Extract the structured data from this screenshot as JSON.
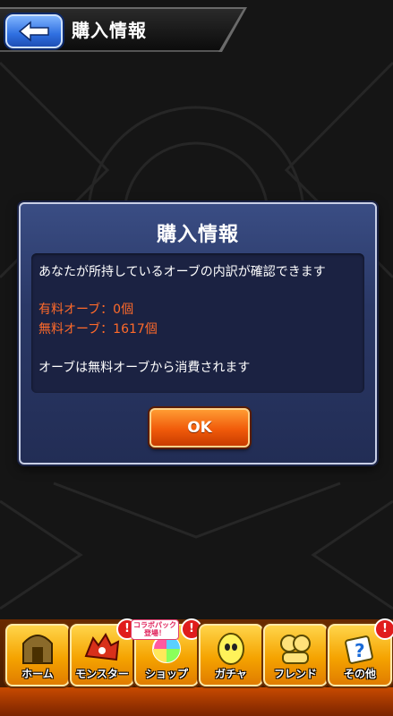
{
  "header": {
    "back_icon": "arrow-left-icon",
    "title": "購入情報"
  },
  "modal": {
    "title": "購入情報",
    "description": "あなたが所持しているオーブの内訳が確認できます",
    "paid_orbs": "有料オーブ：0個",
    "free_orbs": "無料オーブ：1617個",
    "note": "オーブは無料オーブから消費されます",
    "ok_label": "OK"
  },
  "nav": {
    "items": [
      {
        "label": "ホーム",
        "icon": "home-icon"
      },
      {
        "label": "モンスター",
        "icon": "monster-icon",
        "alert": "!"
      },
      {
        "label": "ショップ",
        "icon": "shop-orb-icon",
        "alert": "!",
        "tag": "コラボパック登場！"
      },
      {
        "label": "ガチャ",
        "icon": "gacha-egg-icon"
      },
      {
        "label": "フレンド",
        "icon": "friend-icon"
      },
      {
        "label": "その他",
        "icon": "other-icon",
        "alert": "!"
      }
    ]
  },
  "colors": {
    "accent_red": "#ff6a2a",
    "modal_bg": "#2a3866",
    "ok_orange": "#f05a0a",
    "nav_yellow": "#f5a300"
  }
}
